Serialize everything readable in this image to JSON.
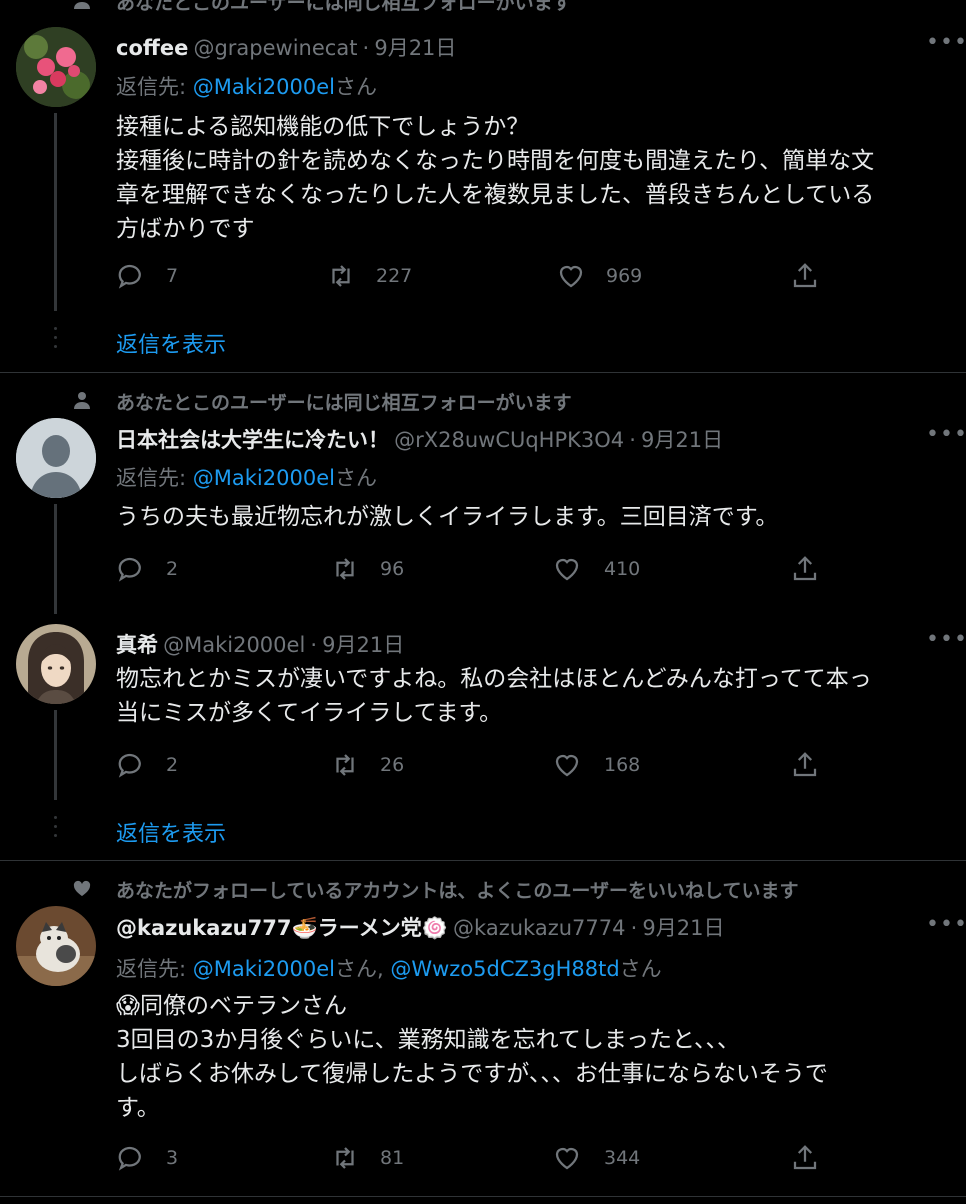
{
  "tweet1": {
    "context": "あなたとこのユーザーには同じ相互フォローがいます",
    "name": "coffee",
    "handle": "@grapewinecat",
    "sep": "·",
    "date": "9月21日",
    "reply_prefix": "返信先:",
    "reply_to": "@Maki2000el",
    "reply_suffix": "さん",
    "lines": [
      "接種による認知機能の低下でしょうか？",
      "接種後に時計の針を読めなくなったり時間を何度も間違えたり、簡単な文",
      "章を理解できなくなったりした人を複数見ました、普段きちんとしている",
      "方ばかりです"
    ],
    "replies": "7",
    "retweets": "227",
    "likes": "969",
    "show_replies": "返信を表示"
  },
  "tweet2": {
    "context": "あなたとこのユーザーには同じ相互フォローがいます",
    "name": "日本社会は大学生に冷たい！",
    "handle": "@rX28uwCUqHPK3O4",
    "sep": "·",
    "date": "9月21日",
    "reply_prefix": "返信先:",
    "reply_to": "@Maki2000el",
    "reply_suffix": "さん",
    "lines": [
      "うちの夫も最近物忘れが激しくイライラします。三回目済です。"
    ],
    "replies": "2",
    "retweets": "96",
    "likes": "410"
  },
  "tweet3": {
    "name": "真希",
    "handle": "@Maki2000el",
    "sep": "·",
    "date": "9月21日",
    "lines": [
      "物忘れとかミスが凄いですよね。私の会社はほとんどみんな打ってて本っ",
      "当にミスが多くてイライラしてます。"
    ],
    "replies": "2",
    "retweets": "26",
    "likes": "168",
    "show_replies": "返信を表示"
  },
  "tweet4": {
    "context": "あなたがフォローしているアカウントは、よくこのユーザーをいいねしています",
    "name_a": "@kazukazu777",
    "ramen_emoji": "🍜",
    "name_b": "ラーメン党",
    "naruto_emoji": "🍥",
    "handle": "@kazukazu7774",
    "sep": "·",
    "date": "9月21日",
    "reply_prefix": "返信先:",
    "reply_to": "@Maki2000el",
    "reply_mid": "さん,",
    "reply_to2": "@Wwzo5dCZ3gH88td",
    "reply_suffix": "さん",
    "emoji": "😱",
    "line1": "同僚のベテランさん",
    "lines": [
      "3回目の3か月後ぐらいに、業務知識を忘れてしまったと、、、",
      "しばらくお休みして復帰したようですが、、、お仕事にならないそうで",
      "す。"
    ],
    "replies": "3",
    "retweets": "81",
    "likes": "344"
  },
  "colors": {
    "accent": "#1d9bf0",
    "muted": "#71767b",
    "text": "#e7e9ea",
    "bg": "#000000"
  },
  "icons": [
    "person-icon",
    "heart-icon",
    "reply-icon",
    "retweet-icon",
    "like-icon",
    "share-icon",
    "more-icon"
  ]
}
